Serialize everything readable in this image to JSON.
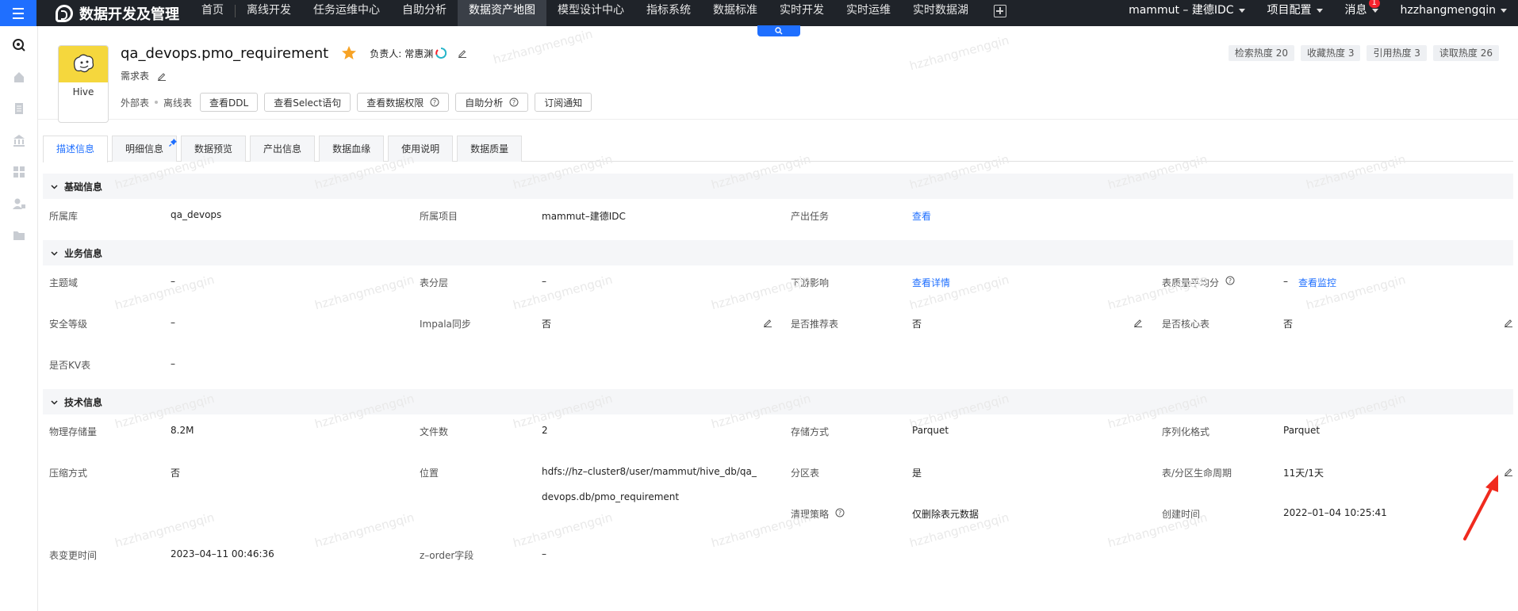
{
  "nav": {
    "brand": "数据开发及管理",
    "items": [
      "首页",
      "离线开发",
      "任务运维中心",
      "自助分析",
      "数据资产地图",
      "模型设计中心",
      "指标系统",
      "数据标准",
      "实时开发",
      "实时运维",
      "实时数据湖"
    ],
    "active": "数据资产地图",
    "project": "mammut – 建德IDC",
    "config": "项目配置",
    "messages": "消息",
    "message_count": "1",
    "user": "hzzhangmengqin"
  },
  "header": {
    "hive_label": "Hive",
    "table_name": "qa_devops.pmo_requirement",
    "owner_label": "负责人:",
    "owner_name": "常惠渊",
    "description": "需求表",
    "tag1": "外部表",
    "tag2": "离线表",
    "buttons": [
      "查看DDL",
      "查看Select语句",
      "查看数据权限",
      "自助分析",
      "订阅通知"
    ],
    "heat": [
      "检索热度 20",
      "收藏热度 3",
      "引用热度 3",
      "读取热度 26"
    ]
  },
  "tabs": [
    "描述信息",
    "明细信息",
    "数据预览",
    "产出信息",
    "数据血缘",
    "使用说明",
    "数据质量"
  ],
  "basic": {
    "title": "基础信息",
    "db_label": "所属库",
    "db_value": "qa_devops",
    "project_label": "所属项目",
    "project_value": "mammut–建德IDC",
    "task_label": "产出任务",
    "task_value": "查看"
  },
  "business": {
    "title": "业务信息",
    "topic_label": "主题域",
    "topic_value": "–",
    "layer_label": "表分层",
    "layer_value": "–",
    "downstream_label": "下游影响",
    "downstream_value": "查看详情",
    "quality_label": "表质量平均分",
    "quality_value": "–",
    "quality_link": "查看监控",
    "security_label": "安全等级",
    "security_value": "–",
    "impala_label": "Impala同步",
    "impala_value": "否",
    "recommend_label": "是否推荐表",
    "recommend_value": "否",
    "core_label": "是否核心表",
    "core_value": "否",
    "kv_label": "是否KV表",
    "kv_value": "–"
  },
  "tech": {
    "title": "技术信息",
    "storage_label": "物理存储量",
    "storage_value": "8.2M",
    "files_label": "文件数",
    "files_value": "2",
    "format_label": "存储方式",
    "format_value": "Parquet",
    "serde_label": "序列化格式",
    "serde_value": "Parquet",
    "compress_label": "压缩方式",
    "compress_value": "否",
    "location_label": "位置",
    "location_line1": "hdfs://hz–cluster8/user/mammut/hive_db/qa_",
    "location_line2": "devops.db/pmo_requirement",
    "partition_label": "分区表",
    "partition_value": "是",
    "lifecycle_label": "表/分区生命周期",
    "lifecycle_value": "11天/1天",
    "cleanup_label": "清理策略",
    "cleanup_value": "仅删除表元数据",
    "created_label": "创建时间",
    "created_value": "2022–01–04 10:25:41",
    "changed_label": "表变更时间",
    "changed_value": "2023–04–11 00:46:36",
    "zorder_label": "z–order字段",
    "zorder_value": "–"
  },
  "watermark": "hzzhangmengqin"
}
